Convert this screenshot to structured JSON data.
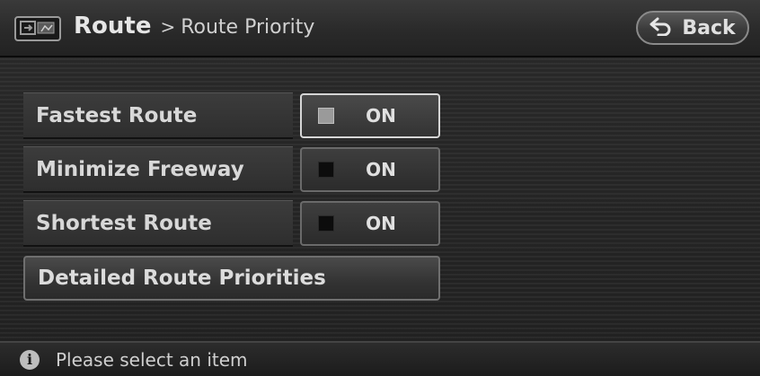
{
  "header": {
    "icon": "map-screen-icon",
    "breadcrumb_main": "Route",
    "breadcrumb_sep": ">",
    "breadcrumb_sub": "Route Priority",
    "back_label": "Back",
    "back_icon": "back-arrow-icon"
  },
  "options": [
    {
      "label": "Fastest Route",
      "state": "ON",
      "selected": true
    },
    {
      "label": "Minimize Freeway",
      "state": "ON",
      "selected": false
    },
    {
      "label": "Shortest Route",
      "state": "ON",
      "selected": false
    }
  ],
  "detailed_button_label": "Detailed Route Priorities",
  "status": {
    "icon": "info-icon",
    "info_glyph": "i",
    "message": "Please select an item"
  }
}
